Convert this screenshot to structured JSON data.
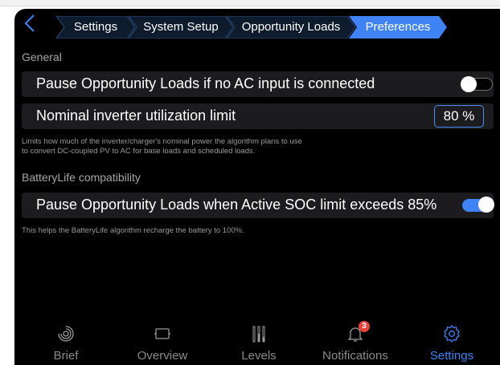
{
  "breadcrumb": {
    "items": [
      "Settings",
      "System Setup",
      "Opportunity Loads",
      "Preferences"
    ],
    "active_index": 3
  },
  "general": {
    "label": "General",
    "pause_no_ac": {
      "label": "Pause Opportunity Loads if no AC input is connected",
      "enabled": false
    },
    "inverter_limit": {
      "label": "Nominal inverter utilization limit",
      "value": "80 %",
      "description_line1": "Limits how much of the inverter/charger's nominal power the algorithm plans to use",
      "description_line2": "to convert DC-coupled PV to AC for base loads and scheduled loads."
    }
  },
  "batterylife": {
    "label": "BatteryLife compatibility",
    "pause_soc": {
      "label": "Pause Opportunity Loads when Active SOC limit exceeds 85%",
      "enabled": true
    },
    "description": "This helps the BatteryLife algorithm recharge the battery to 100%."
  },
  "nav": {
    "items": [
      {
        "label": "Brief",
        "icon": "brief-icon"
      },
      {
        "label": "Overview",
        "icon": "overview-icon"
      },
      {
        "label": "Levels",
        "icon": "levels-icon"
      },
      {
        "label": "Notifications",
        "icon": "bell-icon",
        "badge": "3"
      },
      {
        "label": "Settings",
        "icon": "gear-icon"
      }
    ],
    "active_index": 4
  },
  "colors": {
    "accent": "#3f83f7",
    "background": "#000000",
    "row": "#1c1c1e",
    "badge": "#e8443c"
  }
}
